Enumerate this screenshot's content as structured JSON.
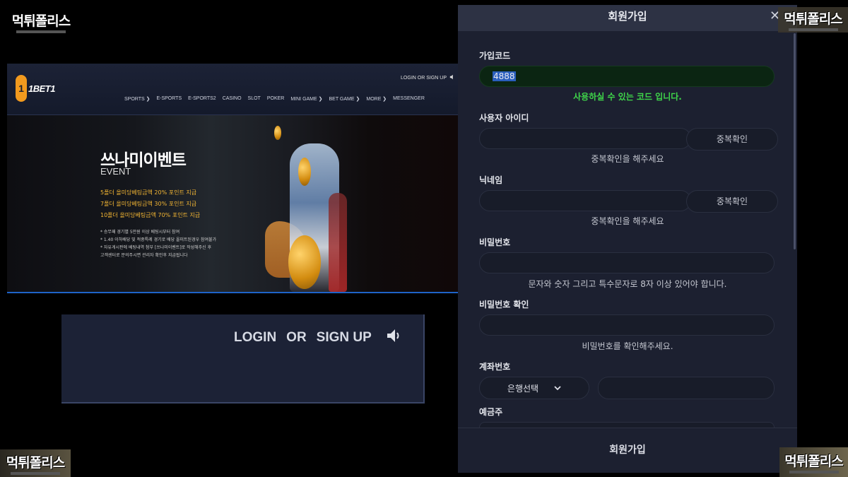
{
  "watermark": {
    "text": "먹튀폴리스"
  },
  "site": {
    "logo_text": "1BET1",
    "login_text": "LOGIN OR SIGN UP",
    "nav": [
      "SPORTS ❯",
      "E-SPORTS",
      "E-SPORTS2",
      "CASINO",
      "SLOT",
      "POKER",
      "MINI GAME ❯",
      "BET GAME ❯",
      "MORE ❯",
      "MESSENGER"
    ],
    "banner": {
      "title": "쓰나미이벤트",
      "subtitle": "EVENT",
      "lines": [
        "5폴더 올미당베팅금액 20% 포인트 지급",
        "7폴더 올미당베팅금액 30% 포인트 지급",
        "10폴더 올미당베팅금액 70% 포인트 지급"
      ],
      "notes": [
        "* 승무패 경기별 5만원 이상 베팅시부터 참여",
        "* 1.40 이하배당 및 적중특례 경기로 배당 올미트된경우 참여불가",
        "* 자유게시판에 베팅내역 첨부 [쓰나미이벤트]로 작성해주신 후",
        "고객센터로 문의주시면 관리자 확인후 지급됩니다"
      ]
    }
  },
  "zoom": {
    "login": "LOGIN",
    "or": "OR",
    "signup": "SIGN UP"
  },
  "modal": {
    "title": "회원가입",
    "close": "✕",
    "fields": {
      "join_code": {
        "label": "가입코드",
        "value": "4888",
        "message": "사용하실 수 있는 코드 입니다."
      },
      "user_id": {
        "label": "사용자 아이디",
        "button": "중복확인",
        "hint": "중복확인을 해주세요"
      },
      "nickname": {
        "label": "닉네임",
        "button": "중복확인",
        "hint": "중복확인을 해주세요"
      },
      "password": {
        "label": "비밀번호",
        "hint": "문자와 숫자 그리고 특수문자로 8자 이상 있어야 합니다."
      },
      "password_confirm": {
        "label": "비밀번호 확인",
        "hint": "비밀번호를 확인해주세요."
      },
      "account": {
        "label": "계좌번호",
        "bank_select": "은행선택"
      },
      "depositor": {
        "label": "예금주"
      }
    },
    "submit": "회원가입"
  }
}
